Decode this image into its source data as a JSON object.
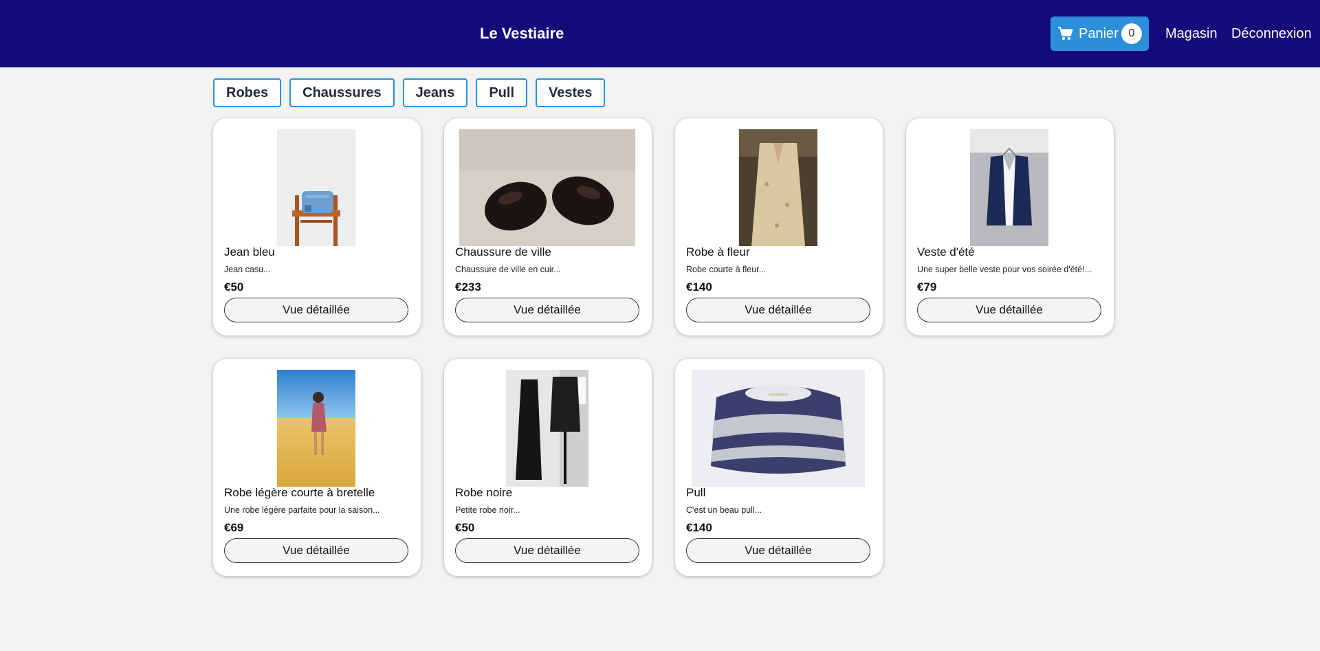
{
  "header": {
    "brand": "Le Vestiaire",
    "cart": {
      "label": "Panier",
      "count": "0",
      "icon": "shopping-cart-icon"
    },
    "links": [
      "Magasin",
      "Déconnexion"
    ]
  },
  "categories": [
    "Robes",
    "Chaussures",
    "Jeans",
    "Pull",
    "Vestes"
  ],
  "products": [
    {
      "title": "Jean bleu",
      "description": "Jean casu...",
      "price": "€50",
      "button": "Vue détaillée"
    },
    {
      "title": "Chaussure de ville",
      "description": "Chaussure de ville en cuir...",
      "price": "€233",
      "button": "Vue détaillée"
    },
    {
      "title": "Robe à fleur",
      "description": "Robe courte à fleur...",
      "price": "€140",
      "button": "Vue détaillée"
    },
    {
      "title": "Veste d'été",
      "description": "Une super belle veste pour vos soirée d'été!...",
      "price": "€79",
      "button": "Vue détaillée"
    },
    {
      "title": "Robe légère courte à bretelle",
      "description": "Une robe légère parfaite pour la saison...",
      "price": "€69",
      "button": "Vue détaillée"
    },
    {
      "title": "Robe noire",
      "description": "Petite robe noir...",
      "price": "€50",
      "button": "Vue détaillée"
    },
    {
      "title": "Pull",
      "description": "C'est un beau pull...",
      "price": "€140",
      "button": "Vue détaillée"
    }
  ],
  "colors": {
    "navbar": "#140a7a",
    "accent": "#2b8fd9",
    "background": "#f3f3f3"
  }
}
